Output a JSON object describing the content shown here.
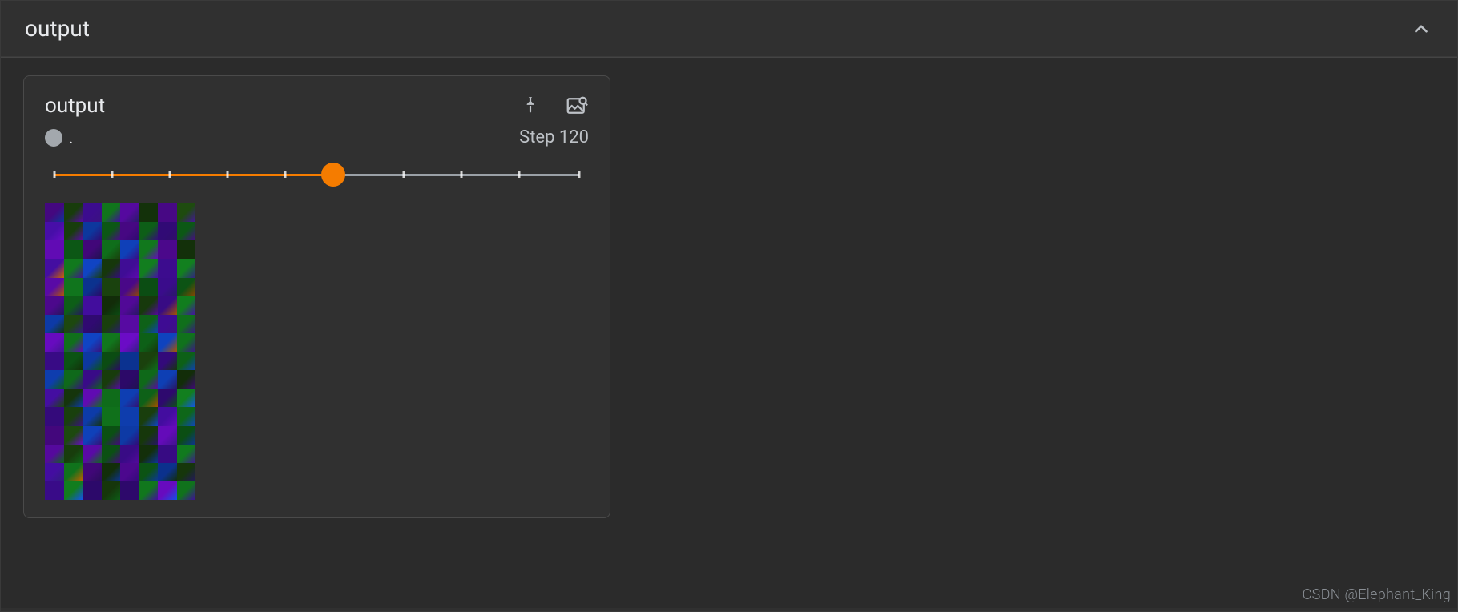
{
  "panel": {
    "title": "output"
  },
  "card": {
    "title": "output",
    "run_name": ".",
    "step_label": "Step 120",
    "slider": {
      "percent": 53,
      "ticks_pct": [
        0,
        11,
        22,
        33,
        44,
        66.5,
        77.5,
        88.5,
        100
      ]
    }
  },
  "watermark": "CSDN @Elephant_King",
  "image_colors": [
    "#2b1a6e",
    "#0f6b1a",
    "#3c0c8f",
    "#5a0aa7",
    "#1046c8",
    "#193f0d",
    "#b35a00",
    "#3a1280"
  ],
  "image_grid": {
    "cols": 8,
    "rows": 16
  }
}
